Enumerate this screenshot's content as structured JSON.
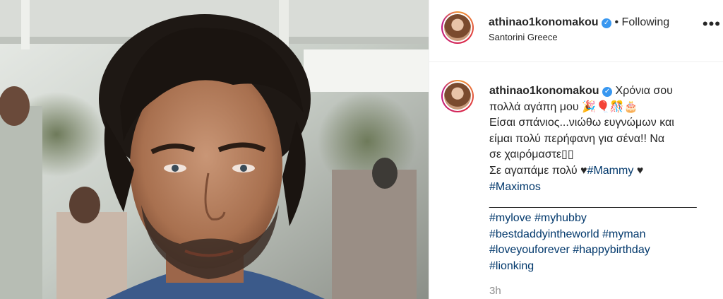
{
  "post": {
    "username": "athinao1konomakou",
    "follow_status": "Following",
    "separator": "•",
    "location": "Santorini Greece",
    "more_icon": "•••",
    "verified_icon": "check-badge",
    "time_ago": "3h"
  },
  "caption": {
    "username": "athinao1konomakou",
    "line1": "Χρόνια σου",
    "line2": "πολλά αγάπη μου 🎉🎈🎊🎂",
    "line3": "Είσαι σπάνιος...νιώθω ευγνώμων και",
    "line4": "είμαι πολύ περήφανη για σένα!! Να",
    "line5": "σε χαιρόμαστε▯▯",
    "line6_text": "Σε αγαπάμε πολύ ",
    "heart": "♥",
    "tag_mammy": "#Mammy",
    "tag_maximos": "#Maximos",
    "divider": "_________________________________",
    "tags": [
      [
        "#mylove",
        "#myhubby"
      ],
      [
        "#bestdaddyintheworld",
        "#myman"
      ],
      [
        "#loveyouforever",
        "#happybirthday"
      ],
      [
        "#lionking"
      ]
    ]
  },
  "colors": {
    "text": "#262626",
    "hashtag": "#00376b",
    "verified": "#3897f0",
    "muted": "#8e8e8e"
  }
}
